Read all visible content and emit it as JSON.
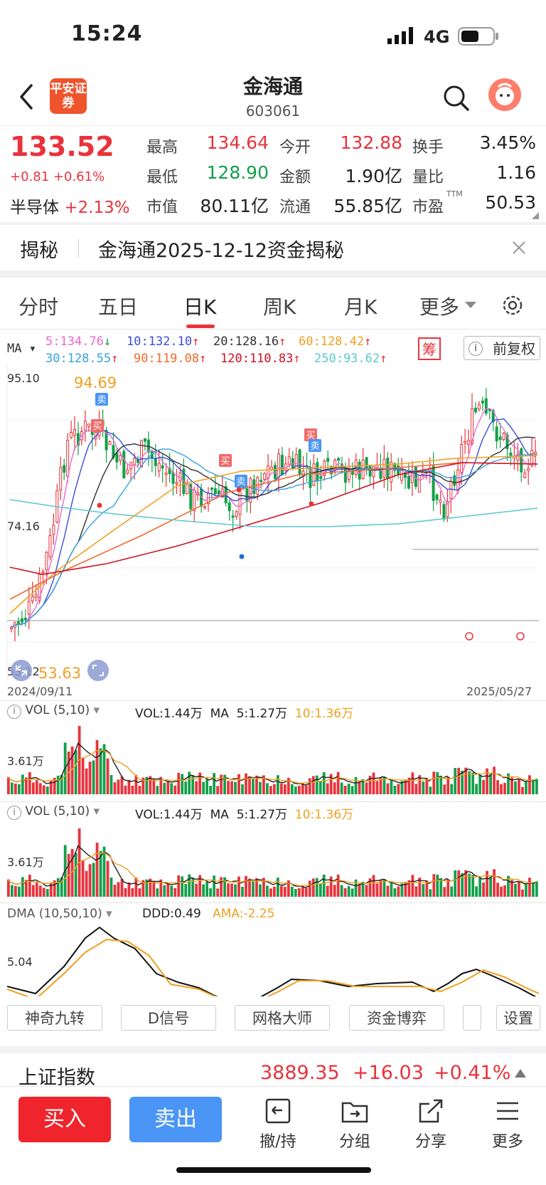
{
  "status": {
    "time": "15:24",
    "network": "4G"
  },
  "header": {
    "broker_logo": "平安证券",
    "title": "金海通",
    "code": "603061"
  },
  "quote": {
    "price": "133.52",
    "change": "+0.81",
    "change_pct": "+0.61%",
    "sector_name": "半导体",
    "sector_change": "+2.13%",
    "fields": [
      {
        "label": "最高",
        "value": "134.64",
        "color": "#e8333c"
      },
      {
        "label": "今开",
        "value": "132.88",
        "color": "#e8333c"
      },
      {
        "label": "换手",
        "value": "3.45%",
        "color": "#222222"
      },
      {
        "label": "最低",
        "value": "128.90",
        "color": "#13a04a"
      },
      {
        "label": "金额",
        "value": "1.90亿",
        "color": "#222222"
      },
      {
        "label": "量比",
        "value": "1.16",
        "color": "#222222"
      },
      {
        "label": "市值",
        "value": "80.11亿",
        "color": "#222222"
      },
      {
        "label": "流通",
        "value": "55.85亿",
        "color": "#222222"
      },
      {
        "label": "市盈",
        "value": "50.53",
        "color": "#222222",
        "sup": "TTM"
      }
    ]
  },
  "reveal": {
    "label": "揭秘",
    "text": "金海通2025-12-12资金揭秘"
  },
  "tabs": [
    "分时",
    "五日",
    "日K",
    "周K",
    "月K",
    "更多"
  ],
  "active_tab": "日K",
  "ma_legend": {
    "label": "MA",
    "items": [
      {
        "text": "5:134.76",
        "arrow": "↓",
        "color": "#e86bd0"
      },
      {
        "text": "10:132.10",
        "arrow": "↑",
        "color": "#3a4fd8"
      },
      {
        "text": "20:128.16",
        "arrow": "↑",
        "color": "#333333"
      },
      {
        "text": "60:128.42",
        "arrow": "↑",
        "color": "#f0a020"
      },
      {
        "text": "30:128.55",
        "arrow": "↑",
        "color": "#3aa0e0"
      },
      {
        "text": "90:119.08",
        "arrow": "↑",
        "color": "#f06a30"
      },
      {
        "text": "120:110.83",
        "arrow": "↑",
        "color": "#d01020"
      },
      {
        "text": "250:93.62",
        "arrow": "↑",
        "color": "#5cc8d0"
      }
    ],
    "chou_label": "筹",
    "restore_label": "前复权"
  },
  "main_chart": {
    "y_top": "95.10",
    "y_mid": "74.16",
    "y_bottom": "53.12",
    "high_mark": "94.69",
    "low_mark": "53.63",
    "date_start": "2024/09/11",
    "date_end": "2025/05/27",
    "signals": [
      "卖",
      "买",
      "买",
      "买",
      "卖",
      "卖"
    ]
  },
  "volume_panels": [
    {
      "name": "VOL (5,10)",
      "vol": "VOL:1.44万",
      "ma": "MA",
      "ma5": "5:1.27万",
      "ma10": "10:1.36万",
      "axis": "3.61万"
    },
    {
      "name": "VOL (5,10)",
      "vol": "VOL:1.44万",
      "ma": "MA",
      "ma5": "5:1.27万",
      "ma10": "10:1.36万",
      "axis": "3.61万"
    }
  ],
  "dma_panel": {
    "name": "DMA (10,50,10)",
    "ddd": "DDD:0.49",
    "ama": "AMA:-2.25",
    "axis": "5.04"
  },
  "tools": [
    "神奇九转",
    "D信号",
    "网格大师",
    "资金博弈",
    "设置"
  ],
  "index_bar": {
    "name": "上证指数",
    "value": "3889.35",
    "change": "+16.03",
    "change_pct": "+0.41%"
  },
  "bottom": {
    "buy": "买入",
    "sell": "卖出",
    "items": [
      "撤/持",
      "分组",
      "分享",
      "更多"
    ]
  }
}
